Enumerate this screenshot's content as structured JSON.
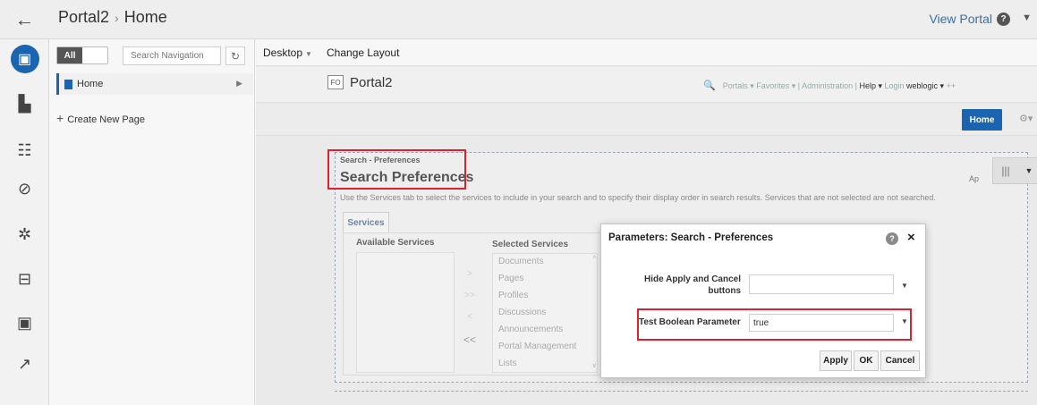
{
  "topbar": {
    "crumbs": [
      "Portal2",
      "Home"
    ],
    "separator": "›",
    "view_portal": "View Portal",
    "help_glyph": "?",
    "caret": "▼",
    "back_icon": "left-arrow-icon"
  },
  "rail": {
    "icons": [
      "pages-icon",
      "document-icon",
      "users-icon",
      "compass-icon",
      "settings-icon",
      "toolbox-icon",
      "portlet-icon",
      "build-icon"
    ]
  },
  "nav": {
    "toggle_label": "All",
    "search_placeholder": "Search Navigation",
    "refresh_glyph": "↻",
    "home_item": "Home",
    "expand_glyph": "▶",
    "create_page": "Create New Page",
    "plus_glyph": "+"
  },
  "toolbar": {
    "desktop": "Desktop",
    "caret": "▼",
    "change_layout": "Change Layout"
  },
  "portal": {
    "logo_text": "FO",
    "title": "Portal2",
    "search_glyph": "🔍",
    "links_light1": "Portals ▾ Favorites ▾ | Administration | ",
    "links_dark1": "Help ▾",
    "links_light2": " Login ",
    "links_dark2": "weblogic ▾",
    "links_light3": " ++",
    "home_button": "Home",
    "gear_glyph": "⚙▾"
  },
  "portlet": {
    "small_title": "Search - Preferences",
    "title": "Search Preferences",
    "description": "Use the Services tab to select the services to include in your search and to specify their display order in search results. Services that are not selected are not searched.",
    "ap_text": "Ap",
    "ctrl_bars": "|||",
    "ctrl_caret": "▼",
    "tab_services": "Services",
    "available_label": "Available Services",
    "selected_label": "Selected Services",
    "move_glyphs": [
      ">",
      ">>",
      "<",
      "<<"
    ],
    "selected_services": [
      "Documents",
      "Pages",
      "Profiles",
      "Discussions",
      "Announcements",
      "Portal Management",
      "Lists"
    ],
    "scroll_up": "^",
    "scroll_down": "v"
  },
  "dialog": {
    "title": "Parameters: Search - Preferences",
    "help_glyph": "?",
    "close_glyph": "×",
    "hide_label": "Hide Apply and Cancel buttons",
    "hide_value": "",
    "bool_label": "Test Boolean Parameter",
    "bool_value": "true",
    "caret": "▼",
    "apply": "Apply",
    "ok": "OK",
    "cancel": "Cancel"
  },
  "colors": {
    "accent": "#1a64b0",
    "highlight": "#e0202a"
  }
}
